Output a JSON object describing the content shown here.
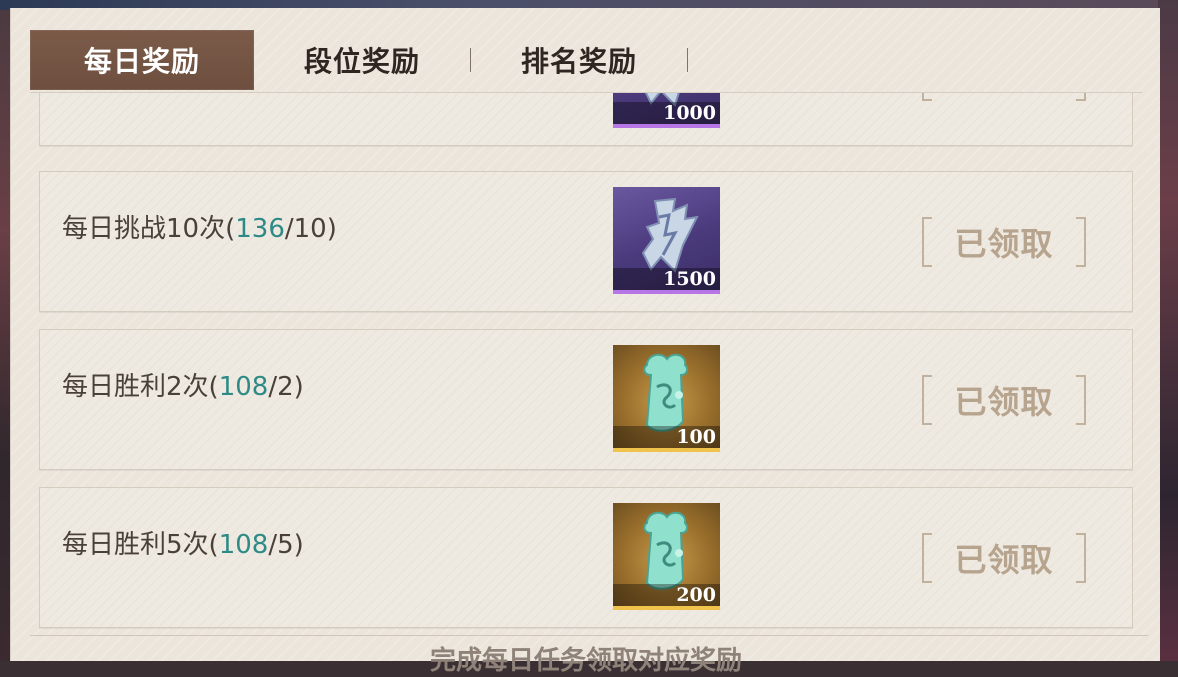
{
  "tabs": [
    {
      "label": "每日奖励",
      "active": true
    },
    {
      "label": "段位奖励",
      "active": false
    },
    {
      "label": "排名奖励",
      "active": false
    }
  ],
  "tasks": [
    {
      "label_before": "",
      "progress": "",
      "label_after": "",
      "reward_qty": "1000",
      "reward_icon": "silver-spirit-shard-icon",
      "status": ""
    },
    {
      "label_before": "每日挑战10次(",
      "progress": "136",
      "label_after": "/10)",
      "reward_qty": "1500",
      "reward_icon": "silver-spirit-shard-icon",
      "status": "已领取"
    },
    {
      "label_before": "每日胜利2次(",
      "progress": "108",
      "label_after": "/2)",
      "reward_qty": "100",
      "reward_icon": "jade-token-icon",
      "status": "已领取"
    },
    {
      "label_before": "每日胜利5次(",
      "progress": "108",
      "label_after": "/5)",
      "reward_qty": "200",
      "reward_icon": "jade-token-icon",
      "status": "已领取"
    }
  ],
  "footer": {
    "text": "完成每日任务领取对应奖励"
  },
  "colors": {
    "active_tab": "#6e4f3f",
    "progress_teal": "#2e8a86",
    "claimed_beige": "#b7a48e",
    "purple_rarity": "#b676e6",
    "gold_rarity": "#f0c44c"
  }
}
